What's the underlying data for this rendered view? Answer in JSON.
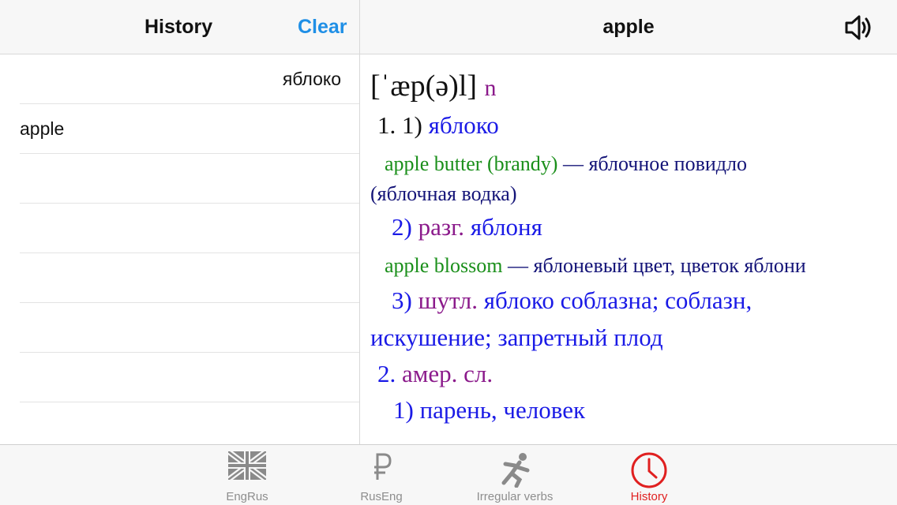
{
  "history_pane": {
    "title": "History",
    "clear_label": "Clear",
    "items": [
      "яблоко",
      "apple"
    ]
  },
  "article_pane": {
    "title": "apple",
    "speaker_icon": "speaker-icon",
    "transcription": "[ˈæp(ə)l]",
    "part_of_speech": "n",
    "entries": {
      "e1_num": "1. 1)",
      "e1_text": "яблоко",
      "ex1_en": "apple butter (brandy)",
      "ex1_ru": " — яблочное повидло",
      "ex1_ru2": "(яблочная водка)",
      "e2_num": "2)",
      "e2_label": "разг.",
      "e2_text": "яблоня",
      "ex2_en": "apple blossom",
      "ex2_ru": " — яблоневый цвет, цветок яблони",
      "e3_num": "3)",
      "e3_label": "шутл.",
      "e3_text": "яблоко соблазна; соблазн,",
      "e3_text2": "искушение; запретный плод",
      "s2_num": "2.",
      "s2_label": "амер. сл.",
      "s2_1_num": "1)",
      "s2_1_text": "парень, человек"
    }
  },
  "tab_bar": {
    "tabs": [
      {
        "label": "EngRus",
        "icon": "uk-flag-icon",
        "active": false
      },
      {
        "label": "RusEng",
        "icon": "ruble-icon",
        "active": false
      },
      {
        "label": "Irregular verbs",
        "icon": "running-man-icon",
        "active": false
      },
      {
        "label": "History",
        "icon": "clock-icon",
        "active": true
      }
    ]
  },
  "colors": {
    "accent": "#1f8fe6",
    "active_tab": "#e02020",
    "translation": "#1a1ae6",
    "label": "#8b1a8b",
    "example": "#1a8f1a"
  }
}
